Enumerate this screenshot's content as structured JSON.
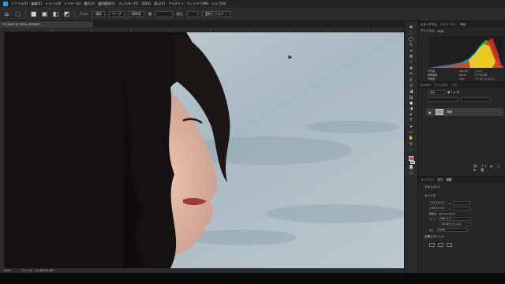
{
  "menubar": {
    "items": [
      "ファイル(F)",
      "編集(E)",
      "イメージ(I)",
      "レイヤー(L)",
      "書式(Y)",
      "選択範囲(S)",
      "フィルター(T)",
      "3D(D)",
      "表示(V)",
      "プラグイン",
      "ウィンドウ(W)",
      "ヘルプ(H)"
    ]
  },
  "options": {
    "tool_icon": "home-icon",
    "mode_label": "ブラシ",
    "blend_value": "通常",
    "feather_label": "ワープ",
    "style_value": "標準用",
    "width_label": "幅",
    "height_label": "高さ",
    "select_button": "選択とマスク..."
  },
  "document": {
    "tab_title": "F3_0607 @ 100% (RGB/8*)"
  },
  "status": {
    "zoom": "100%",
    "info": "ファイル : 24.4M/24.4M"
  },
  "panels": {
    "histogram_tabs": [
      "ヒストグラム",
      "ナビゲーター",
      "情報"
    ],
    "channel_label": "チャンネル:",
    "channel_value": "RGB",
    "stats": [
      [
        "平均値:",
        "101.98",
        "レベル:",
        ""
      ],
      [
        "標準偏差:",
        "80.31",
        "ピクセル数:",
        ""
      ],
      [
        "中間値:",
        "104",
        "パーセントタイル:",
        ""
      ],
      [
        "ピクセル数:",
        "5000000",
        "キャッシュレベル:",
        "1"
      ]
    ],
    "layers_tabs": [
      "レイヤー",
      "チャンネル",
      "パス"
    ],
    "kind_label": "種類",
    "layer_name": "背景",
    "properties_tabs": [
      "ライブラリ",
      "属性",
      "調整"
    ],
    "doc_label": "ドキュメント",
    "canvas_section": "カンバス",
    "canvas_w": "377.78 mm",
    "canvas_h": "283.47 mm",
    "x_label": "X",
    "y_label": "Y",
    "resolution_label": "解像度 : 300 pixel/inch",
    "mode_label": "モード",
    "mode_value": "RGB カラー",
    "bits_value": "16 bit/チャンネル",
    "bg_label": "塗り",
    "bg_value": "背景色",
    "rulers_section": "定規とグリッド"
  },
  "colors": {
    "foreground": "#e3351c",
    "background": "#1a8fe3",
    "accent": "#2da0f0"
  }
}
